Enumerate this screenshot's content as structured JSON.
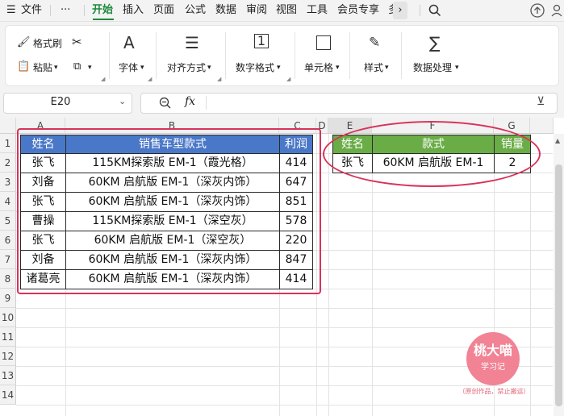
{
  "menu": {
    "file": "文件",
    "more": "···",
    "tabs": [
      "开始",
      "插入",
      "页面",
      "公式",
      "数据",
      "审阅",
      "视图",
      "工具",
      "会员专享"
    ],
    "truncated_tab": "多"
  },
  "ribbon": {
    "format_painter": "格式刷",
    "paste": "粘贴",
    "font": "字体",
    "align": "对齐方式",
    "number_format": "数字格式",
    "cell": "单元格",
    "style": "样式",
    "data_processing": "数据处理"
  },
  "formula_bar": {
    "name_box": "E20",
    "fx": "fx",
    "value": ""
  },
  "columns": [
    "A",
    "B",
    "C",
    "D",
    "E",
    "F",
    "G"
  ],
  "rows": [
    "1",
    "2",
    "3",
    "4",
    "5",
    "6",
    "7",
    "8",
    "9",
    "10",
    "11",
    "12",
    "13",
    "14"
  ],
  "table1": {
    "headers": [
      "姓名",
      "销售车型款式",
      "利润"
    ],
    "rows": [
      [
        "张飞",
        "115KM探索版 EM-1（霞光格）",
        "414"
      ],
      [
        "刘备",
        "60KM 启航版 EM-1（深灰内饰）",
        "647"
      ],
      [
        "张飞",
        "60KM 启航版 EM-1（深灰内饰）",
        "851"
      ],
      [
        "曹操",
        "115KM探索版 EM-1（深空灰）",
        "578"
      ],
      [
        "张飞",
        "60KM 启航版 EM-1（深空灰）",
        "220"
      ],
      [
        "刘备",
        "60KM 启航版 EM-1（深灰内饰）",
        "847"
      ],
      [
        "诸葛亮",
        "60KM 启航版 EM-1（深灰内饰）",
        "414"
      ]
    ]
  },
  "table2": {
    "headers": [
      "姓名",
      "款式",
      "销量"
    ],
    "rows": [
      [
        "张飞",
        "60KM 启航版 EM-1",
        "2"
      ]
    ]
  },
  "watermark": {
    "title": "桃大喵",
    "subtitle": "学习记",
    "caption": "（原创作品，禁止搬运）"
  },
  "colors": {
    "accent_green": "#1e8a3c",
    "header_blue": "#4a78c8",
    "header_green": "#6aac46",
    "annotation_red": "#d9325a"
  }
}
